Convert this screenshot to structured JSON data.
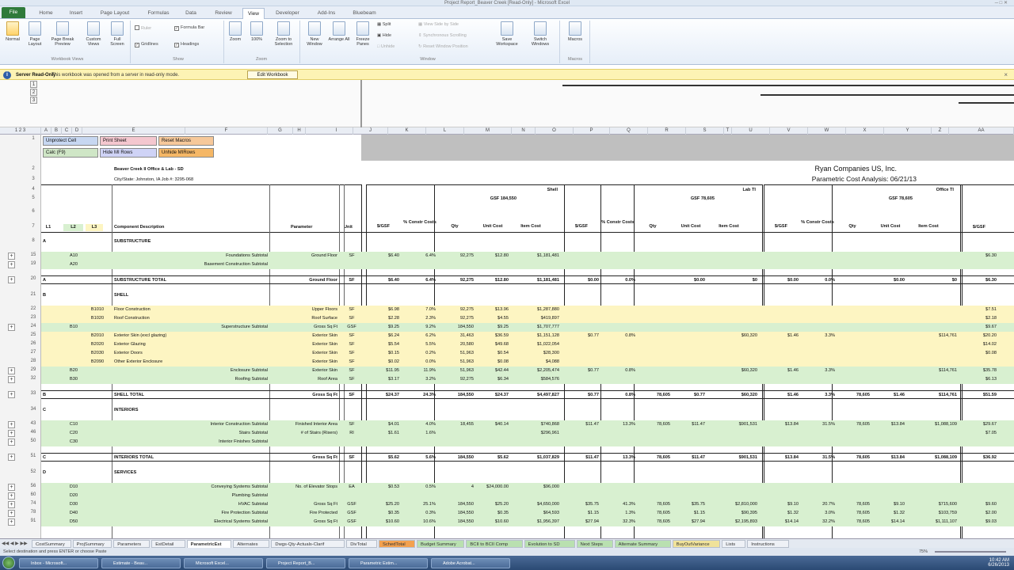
{
  "window": {
    "title": "Project Report_Beaver Creek [Read-Only] - Microsoft Excel"
  },
  "ribbon": {
    "tabs": [
      "File",
      "Home",
      "Insert",
      "Page Layout",
      "Formulas",
      "Data",
      "Review",
      "View",
      "Developer",
      "Add-Ins",
      "Bluebeam"
    ],
    "active_tab": "View",
    "workbook_views": {
      "normal": "Normal",
      "page_layout": "Page Layout",
      "page_break": "Page Break Preview",
      "custom_views": "Custom Views",
      "full_screen": "Full Screen",
      "group": "Workbook Views"
    },
    "show": {
      "ruler": "Ruler",
      "gridlines": "Gridlines",
      "formula_bar": "Formula Bar",
      "headings": "Headings",
      "group": "Show"
    },
    "zoom": {
      "zoom": "Zoom",
      "hundred": "100%",
      "zoom_selection": "Zoom to Selection",
      "group": "Zoom"
    },
    "window_group": {
      "new_window": "New Window",
      "arrange_all": "Arrange All",
      "freeze_panes": "Freeze Panes",
      "split": "Split",
      "hide": "Hide",
      "unhide": "Unhide",
      "side_by_side": "View Side by Side",
      "sync_scroll": "Synchronous Scrolling",
      "reset_pos": "Reset Window Position",
      "save_ws": "Save Workspace",
      "switch_win": "Switch Windows",
      "group": "Window"
    },
    "macros": {
      "macros": "Macros",
      "group": "Macros"
    }
  },
  "message_bar": {
    "title": "Server Read-Only",
    "text": "This workbook was opened from a server in read-only mode.",
    "button": "Edit Workbook"
  },
  "outline_levels": [
    "1",
    "2",
    "3"
  ],
  "col_headers": [
    "A",
    "B",
    "C",
    "D",
    "E",
    "F",
    "G",
    "H",
    "I",
    "J",
    "K",
    "L",
    "M",
    "N",
    "O",
    "P",
    "Q",
    "R",
    "S",
    "T",
    "U",
    "V",
    "W",
    "X",
    "Y",
    "Z",
    "AA"
  ],
  "buttons": {
    "unprotect": "Unprotect Cell",
    "print_sheet": "Print Sheet",
    "reset_macros": "Reset Macros",
    "calc": "Calc (F9)",
    "hide_rows": "Hide MI Rows",
    "unhide_rows": "Unhide MIRows"
  },
  "header": {
    "project": "Beaver Creek II Office & Lab - SD",
    "citystate": "City/State: Johnston, IA  Job #:  3295-068",
    "company": "Ryan Companies US, Inc.",
    "analysis": "Parametric Cost Analysis:  06/21/13",
    "shell_label": "Shell",
    "shell_gsf": "GSF 184,550",
    "lab_label": "Lab TI",
    "lab_gsf": "GSF 78,605",
    "office_label": "Office TI",
    "office_gsf": "GSF 78,605"
  },
  "colnames": {
    "l1": "L1",
    "l2": "L2",
    "l3": "L3",
    "desc": "Component Description",
    "param": "Parameter",
    "unit": "Unit",
    "sgsf": "$/GSF",
    "pct": "% Constr Costs",
    "qty": "Qty",
    "unitcost": "Unit Cost",
    "itemcost": "Item Cost"
  },
  "rows": [
    {
      "num": "8",
      "a": "A",
      "desc": "SUBSTRUCTURE",
      "style": "section"
    },
    {
      "num": "15",
      "b": "A10",
      "desc": "Foundations Subtotal",
      "param": "Ground Floor",
      "unit": "SF",
      "s1": "$6.40",
      "p1": "6.4%",
      "q1": "92,275",
      "u1": "$12.80",
      "i1": "$1,181,481",
      "s3": "$6.30",
      "style": "green"
    },
    {
      "num": "19",
      "b": "A20",
      "desc": "Basement Construction Subtotal",
      "style": "green"
    },
    {
      "num": "20",
      "a": "A",
      "desc": "SUBSTRUCTURE TOTAL",
      "param": "Ground Floor",
      "unit": "SF",
      "s1": "$6.40",
      "p1": "6.4%",
      "q1": "92,275",
      "u1": "$12.80",
      "i1": "$1,181,481",
      "s2": "$0.00",
      "p2": "0.0%",
      "u2": "$0.00",
      "i2": "$0",
      "s2b": "$0.00",
      "p2b": "0.0%",
      "u2b": "$0.00",
      "i2b": "$0",
      "s3": "$6.30",
      "style": "total"
    },
    {
      "num": "21",
      "a": "B",
      "desc": "SHELL",
      "style": "section"
    },
    {
      "num": "22",
      "c": "B1010",
      "desc": "Floor Construction",
      "param": "Upper Floors",
      "unit": "SF",
      "s1": "$6.98",
      "p1": "7.0%",
      "q1": "92,275",
      "u1": "$13.96",
      "i1": "$1,287,880",
      "s3": "$7.51",
      "style": "yellow"
    },
    {
      "num": "23",
      "c": "B1020",
      "desc": "Roof Construction",
      "param": "Roof Surface",
      "unit": "SF",
      "s1": "$2.28",
      "p1": "2.3%",
      "q1": "92,275",
      "u1": "$4.55",
      "i1": "$419,897",
      "s3": "$2.18",
      "style": "yellow"
    },
    {
      "num": "24",
      "b": "B10",
      "desc": "Superstructure Subtotal",
      "param": "Gross Sq Ft",
      "unit": "GSF",
      "s1": "$9.25",
      "p1": "9.2%",
      "q1": "184,550",
      "u1": "$9.25",
      "i1": "$1,707,777",
      "s3": "$9.67",
      "style": "green"
    },
    {
      "num": "25",
      "c": "B2010",
      "desc": "Exterior Skin (excl glazing)",
      "param": "Exterior Skin",
      "unit": "SF",
      "s1": "$6.24",
      "p1": "6.2%",
      "q1": "31,463",
      "u1": "$36.59",
      "i1": "$1,151,128",
      "s2": "$0.77",
      "p2": "0.8%",
      "i2": "$60,320",
      "s2b": "$1.46",
      "p2b": "3.3%",
      "i2b": "$114,761",
      "s3": "$20.20",
      "style": "yellow"
    },
    {
      "num": "26",
      "c": "B2020",
      "desc": "Exterior Glazing",
      "param": "Exterior Skin",
      "unit": "SF",
      "s1": "$5.54",
      "p1": "5.5%",
      "q1": "20,580",
      "u1": "$49.68",
      "i1": "$1,022,054",
      "s3": "$14.02",
      "style": "yellow"
    },
    {
      "num": "27",
      "c": "B2030",
      "desc": "Exterior Doors",
      "param": "Exterior Skin",
      "unit": "SF",
      "s1": "$0.15",
      "p1": "0.2%",
      "q1": "51,963",
      "u1": "$0.54",
      "i1": "$28,300",
      "s3": "$0.08",
      "style": "yellow"
    },
    {
      "num": "28",
      "c": "B2090",
      "desc": "Other Exterior Enclosure",
      "param": "Exterior Skin",
      "unit": "SF",
      "s1": "$0.02",
      "p1": "0.0%",
      "q1": "51,963",
      "u1": "$0.08",
      "i1": "$4,088",
      "style": "yellow"
    },
    {
      "num": "29",
      "b": "B20",
      "desc": "Enclosure Subtotal",
      "param": "Exterior Skin",
      "unit": "SF",
      "s1": "$11.95",
      "p1": "11.9%",
      "q1": "51,963",
      "u1": "$42.44",
      "i1": "$2,205,474",
      "s2": "$0.77",
      "p2": "0.8%",
      "i2": "$60,320",
      "s2b": "$1.46",
      "p2b": "3.3%",
      "i2b": "$114,761",
      "s3": "$35.78",
      "style": "green"
    },
    {
      "num": "32",
      "b": "B30",
      "desc": "Roofing Subtotal",
      "param": "Roof Area",
      "unit": "SF",
      "s1": "$3.17",
      "p1": "3.2%",
      "q1": "92,275",
      "u1": "$6.34",
      "i1": "$584,576",
      "s3": "$6.13",
      "style": "green"
    },
    {
      "num": "33",
      "a": "B",
      "desc": "SHELL TOTAL",
      "param": "Gross Sq Ft",
      "unit": "SF",
      "s1": "$24.37",
      "p1": "24.3%",
      "q1": "184,550",
      "u1": "$24.37",
      "i1": "$4,497,827",
      "s2": "$0.77",
      "p2": "0.8%",
      "q2": "78,605",
      "u2": "$0.77",
      "i2": "$60,320",
      "s2b": "$1.46",
      "p2b": "3.3%",
      "q2b": "78,605",
      "u2b": "$1.46",
      "i2b": "$114,761",
      "s3": "$51.59",
      "style": "total"
    },
    {
      "num": "34",
      "a": "C",
      "desc": "INTERIORS",
      "style": "section"
    },
    {
      "num": "43",
      "b": "C10",
      "desc": "Interior Construction Subtotal",
      "param": "Finished Interior Area",
      "unit": "SF",
      "s1": "$4.01",
      "p1": "4.0%",
      "q1": "18,455",
      "u1": "$40.14",
      "i1": "$740,868",
      "s2": "$11.47",
      "p2": "13.3%",
      "q2": "78,605",
      "u2": "$11.47",
      "i2": "$901,531",
      "s2b": "$13.84",
      "p2b": "31.5%",
      "q2b": "78,605",
      "u2b": "$13.84",
      "i2b": "$1,088,109",
      "s3": "$29.67",
      "style": "green"
    },
    {
      "num": "46",
      "b": "C20",
      "desc": "Stairs Subtotal",
      "param": "# of Stairs (Risers)",
      "unit": "RI",
      "s1": "$1.61",
      "p1": "1.6%",
      "i1": "$296,961",
      "s3": "$7.05",
      "style": "green"
    },
    {
      "num": "50",
      "b": "C30",
      "desc": "Interior Finishes Subtotal",
      "style": "green"
    },
    {
      "num": "51",
      "a": "C",
      "desc": "INTERIORS TOTAL",
      "param": "Gross Sq Ft",
      "unit": "SF",
      "s1": "$5.62",
      "p1": "5.6%",
      "q1": "184,550",
      "u1": "$5.62",
      "i1": "$1,037,829",
      "s2": "$11.47",
      "p2": "13.3%",
      "q2": "78,605",
      "u2": "$11.47",
      "i2": "$901,531",
      "s2b": "$13.84",
      "p2b": "31.5%",
      "q2b": "78,605",
      "u2b": "$13.84",
      "i2b": "$1,088,109",
      "s3": "$36.92",
      "style": "total"
    },
    {
      "num": "52",
      "a": "D",
      "desc": "SERVICES",
      "style": "section"
    },
    {
      "num": "56",
      "b": "D10",
      "desc": "Conveying Systems Subtotal",
      "param": "No. of Elevator Stops",
      "unit": "EA",
      "s1": "$0.53",
      "p1": "0.5%",
      "q1": "4",
      "u1": "$24,000.00",
      "i1": "$96,000",
      "style": "green"
    },
    {
      "num": "60",
      "b": "D20",
      "desc": "Plumbing Subtotal",
      "style": "green"
    },
    {
      "num": "74",
      "b": "D30",
      "desc": "HVAC Subtotal",
      "param": "Gross Sq Ft",
      "unit": "GSF",
      "s1": "$25.20",
      "p1": "25.1%",
      "q1": "184,550",
      "u1": "$25.20",
      "i1": "$4,650,000",
      "s2": "$35.75",
      "p2": "41.3%",
      "q2": "78,605",
      "u2": "$35.75",
      "i2": "$2,810,000",
      "s2b": "$9.10",
      "p2b": "20.7%",
      "q2b": "78,605",
      "u2b": "$9.10",
      "i2b": "$715,600",
      "s3": "$9.60",
      "style": "green"
    },
    {
      "num": "78",
      "b": "D40",
      "desc": "Fire Protection Subtotal",
      "param": "Fire Protected",
      "unit": "GSF",
      "s1": "$0.35",
      "p1": "0.3%",
      "q1": "184,550",
      "u1": "$0.35",
      "i1": "$64,593",
      "s2": "$1.15",
      "p2": "1.3%",
      "q2": "78,605",
      "u2": "$1.15",
      "i2": "$90,395",
      "s2b": "$1.32",
      "p2b": "3.0%",
      "q2b": "78,605",
      "u2b": "$1.32",
      "i2b": "$103,759",
      "s3": "$2.00",
      "style": "green"
    },
    {
      "num": "91",
      "b": "D50",
      "desc": "Electrical Systems Subtotal",
      "param": "Gross Sq Ft",
      "unit": "GSF",
      "s1": "$10.60",
      "p1": "10.6%",
      "q1": "184,550",
      "u1": "$10.60",
      "i1": "$1,956,397",
      "s2": "$27.94",
      "p2": "32.3%",
      "q2": "78,605",
      "u2": "$27.94",
      "i2": "$2,195,893",
      "s2b": "$14.14",
      "p2b": "32.2%",
      "q2b": "78,605",
      "u2b": "$14.14",
      "i2b": "$1,111,107",
      "s3": "$9.03",
      "style": "green"
    }
  ],
  "sheet_tabs": [
    "CostSummary",
    "ProjSummary",
    "Parameters",
    "EstDetail",
    "ParametricEst",
    "Alternates",
    "Dwgs-Qty-Actuals-Clarif",
    "DivTotal",
    "SchedTotal",
    "Budget Summary",
    "BCII to BCII Comp",
    "Evolution to SD",
    "Next Steps",
    "Alternate Summary",
    "BuyOutVariance",
    "Lists",
    "Instructions"
  ],
  "active_sheet": "ParametricEst",
  "status": {
    "text": "Select destination and press ENTER or choose Paste",
    "zoom": "75%"
  },
  "taskbar": {
    "items": [
      "Inbox - Microsoft...",
      "Estimate - Beav...",
      "Microsoft Excel...",
      "Project Report_B...",
      "Parametric Estim...",
      "Adobe Acrobat..."
    ],
    "time": "10:42 AM",
    "date": "6/26/2013"
  },
  "colors": {
    "green": "#d8f0d0",
    "yellow": "#fdf5c2",
    "message": "#fdf3b4",
    "file_tab": "#2f7a3a"
  }
}
